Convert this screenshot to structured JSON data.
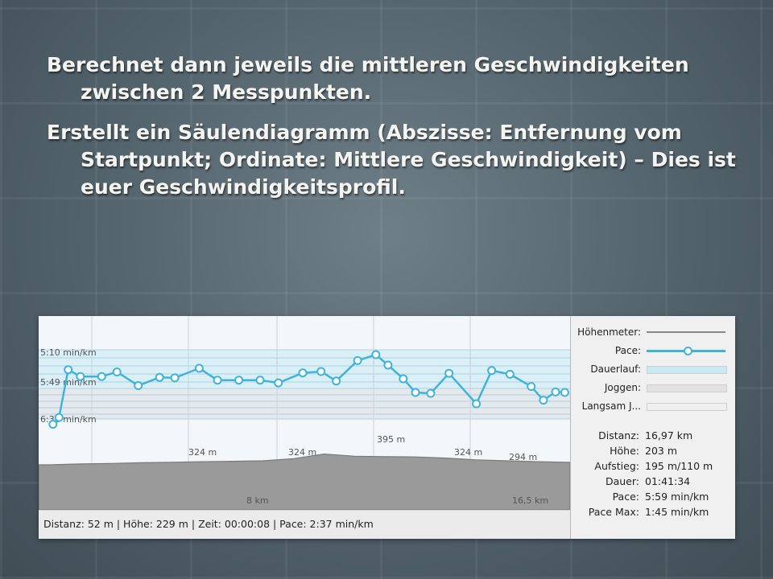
{
  "slide": {
    "bullets": [
      "Berechnet dann jeweils die mittleren Geschwindigkeiten zwischen 2 Messpunkten.",
      "Erstellt ein Säulendiagramm (Abszisse: Entfernung vom Startpunkt; Ordinate: Mittlere Geschwindigkeit) – Dies ist euer Geschwindigkeitsprofil."
    ]
  },
  "screenshot": {
    "pace_ticks": [
      "5:10 min/km",
      "5:49 min/km",
      "6:38 min/km"
    ],
    "km_ticks": [
      "8 km",
      "16,5 km"
    ],
    "elevation_labels": [
      "324 m",
      "324 m",
      "395 m",
      "324 m",
      "294 m"
    ],
    "status_text": "Distanz: 52 m | Höhe: 229 m | Zeit: 00:00:08 | Pace: 2:37 min/km",
    "legend": [
      {
        "label": "Höhenmeter:",
        "color": "#888888",
        "kind": "line"
      },
      {
        "label": "Pace:",
        "color": "#3fb4d8",
        "kind": "line-dot"
      },
      {
        "label": "Dauerlauf:",
        "color": "#c7eaf5",
        "kind": "band"
      },
      {
        "label": "Joggen:",
        "color": "#e2e2e2",
        "kind": "band"
      },
      {
        "label": "Langsam J...",
        "color": "#efefef",
        "kind": "band"
      }
    ],
    "stats": [
      {
        "key": "Distanz:",
        "value": "16,97 km"
      },
      {
        "key": "Höhe:",
        "value": "203 m"
      },
      {
        "key": "Aufstieg:",
        "value": "195 m/110 m"
      },
      {
        "key": "Dauer:",
        "value": "01:41:34"
      },
      {
        "key": "Pace:",
        "value": "5:59 min/km"
      },
      {
        "key": "Pace Max:",
        "value": "1:45 min/km"
      }
    ],
    "colors": {
      "pace": "#3fb4d8",
      "elevation_fill": "#9a9a9a",
      "elevation_line": "#7a7a7a"
    }
  },
  "chart_data": {
    "type": "line",
    "series": [
      {
        "name": "Pace",
        "x": [
          0.1,
          0.3,
          0.6,
          1.0,
          1.7,
          2.2,
          2.9,
          3.6,
          4.1,
          4.9,
          5.5,
          6.2,
          6.9,
          7.5,
          8.3,
          8.9,
          9.4,
          10.1,
          10.7,
          11.1,
          11.6,
          12.0,
          12.5,
          13.1,
          14.0,
          14.5,
          15.1,
          15.8,
          16.2,
          16.6,
          16.9
        ],
        "y": [
          6.75,
          6.6,
          5.55,
          5.7,
          5.7,
          5.6,
          5.9,
          5.72,
          5.73,
          5.52,
          5.78,
          5.78,
          5.78,
          5.84,
          5.62,
          5.59,
          5.8,
          5.35,
          5.22,
          5.45,
          5.75,
          6.05,
          6.07,
          5.63,
          6.3,
          5.57,
          5.65,
          5.92,
          6.22,
          6.04,
          6.05
        ]
      },
      {
        "name": "Höhenmeter",
        "x": [
          0,
          1,
          2,
          3,
          4,
          5,
          6,
          7,
          8,
          9,
          10,
          11,
          12,
          13,
          14,
          15,
          16,
          16.97
        ],
        "y": [
          229,
          236,
          240,
          246,
          250,
          255,
          258,
          262,
          280,
          318,
          300,
          296,
          294,
          285,
          270,
          262,
          255,
          250
        ]
      }
    ]
  }
}
